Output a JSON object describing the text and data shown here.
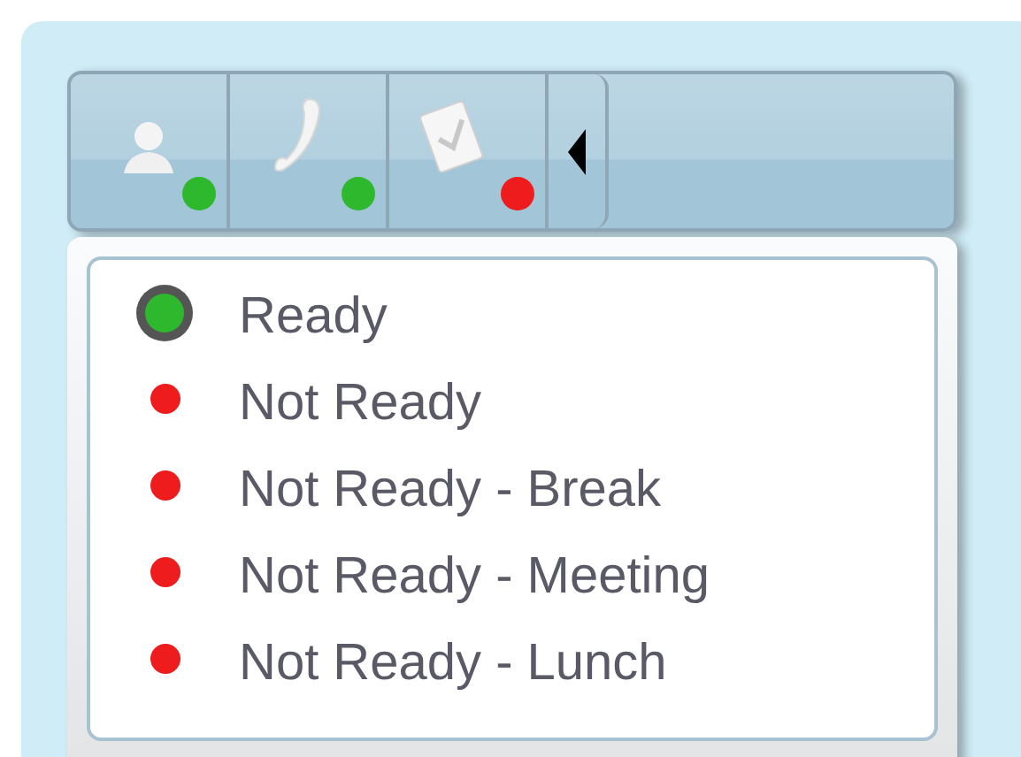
{
  "toolbar": {
    "buttons": [
      {
        "kind": "agent",
        "color": "#2db82d"
      },
      {
        "kind": "phone",
        "color": "#2db82d"
      },
      {
        "kind": "task",
        "color": "#ee1c1c"
      }
    ]
  },
  "status_menu": {
    "items": [
      {
        "label": "Ready",
        "color": "#2db82d",
        "selected": true
      },
      {
        "label": "Not Ready",
        "color": "#ee1c1c",
        "selected": false
      },
      {
        "label": "Not Ready - Break",
        "color": "#ee1c1c",
        "selected": false
      },
      {
        "label": "Not Ready - Meeting",
        "color": "#ee1c1c",
        "selected": false
      },
      {
        "label": "Not Ready - Lunch",
        "color": "#ee1c1c",
        "selected": false
      }
    ]
  }
}
